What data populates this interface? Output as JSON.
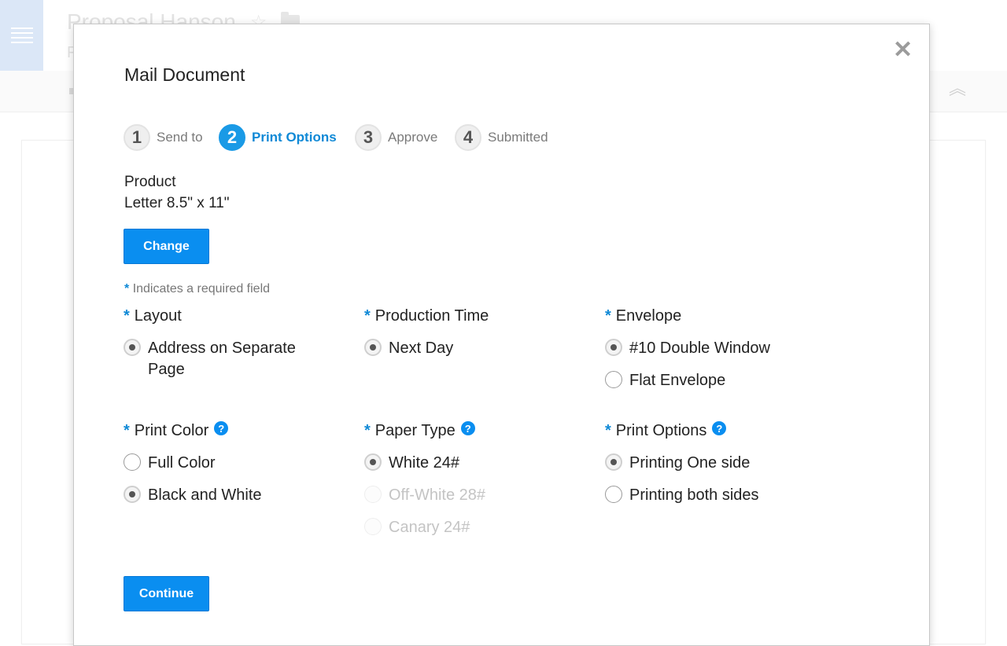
{
  "background": {
    "doc_title": "Proposal Hanson",
    "doc_subtitle": "F"
  },
  "modal": {
    "title": "Mail Document",
    "close_symbol": "✕"
  },
  "stepper": [
    {
      "number": "1",
      "label": "Send to",
      "state": "done"
    },
    {
      "number": "2",
      "label": "Print Options",
      "state": "active"
    },
    {
      "number": "3",
      "label": "Approve",
      "state": "pending"
    },
    {
      "number": "4",
      "label": "Submitted",
      "state": "pending"
    }
  ],
  "product": {
    "label": "Product",
    "value": "Letter 8.5\" x 11\"",
    "change_label": "Change"
  },
  "required_note": {
    "asterisk": "*",
    "text": "Indicates a required field"
  },
  "groups": {
    "layout": {
      "title": "Layout",
      "options": [
        {
          "label": "Address on Separate Page",
          "checked": true,
          "disabled": false
        }
      ]
    },
    "production_time": {
      "title": "Production Time",
      "options": [
        {
          "label": "Next Day",
          "checked": true,
          "disabled": false
        }
      ]
    },
    "envelope": {
      "title": "Envelope",
      "options": [
        {
          "label": "#10 Double Window",
          "checked": true,
          "disabled": false
        },
        {
          "label": "Flat Envelope",
          "checked": false,
          "disabled": false
        }
      ]
    },
    "print_color": {
      "title": "Print Color",
      "help": "?",
      "options": [
        {
          "label": "Full Color",
          "checked": false,
          "disabled": false
        },
        {
          "label": "Black and White",
          "checked": true,
          "disabled": false
        }
      ]
    },
    "paper_type": {
      "title": "Paper Type",
      "help": "?",
      "options": [
        {
          "label": "White 24#",
          "checked": true,
          "disabled": false
        },
        {
          "label": "Off-White 28#",
          "checked": false,
          "disabled": true
        },
        {
          "label": "Canary 24#",
          "checked": false,
          "disabled": true
        }
      ]
    },
    "print_options": {
      "title": "Print Options",
      "help": "?",
      "options": [
        {
          "label": "Printing One side",
          "checked": true,
          "disabled": false
        },
        {
          "label": "Printing both sides",
          "checked": false,
          "disabled": false
        }
      ]
    }
  },
  "continue_label": "Continue",
  "colors": {
    "accent": "#0a8ef0",
    "active_step": "#1a9ae6",
    "active_step_text": "#0f89d6",
    "disabled_text": "#c4c4c4"
  }
}
